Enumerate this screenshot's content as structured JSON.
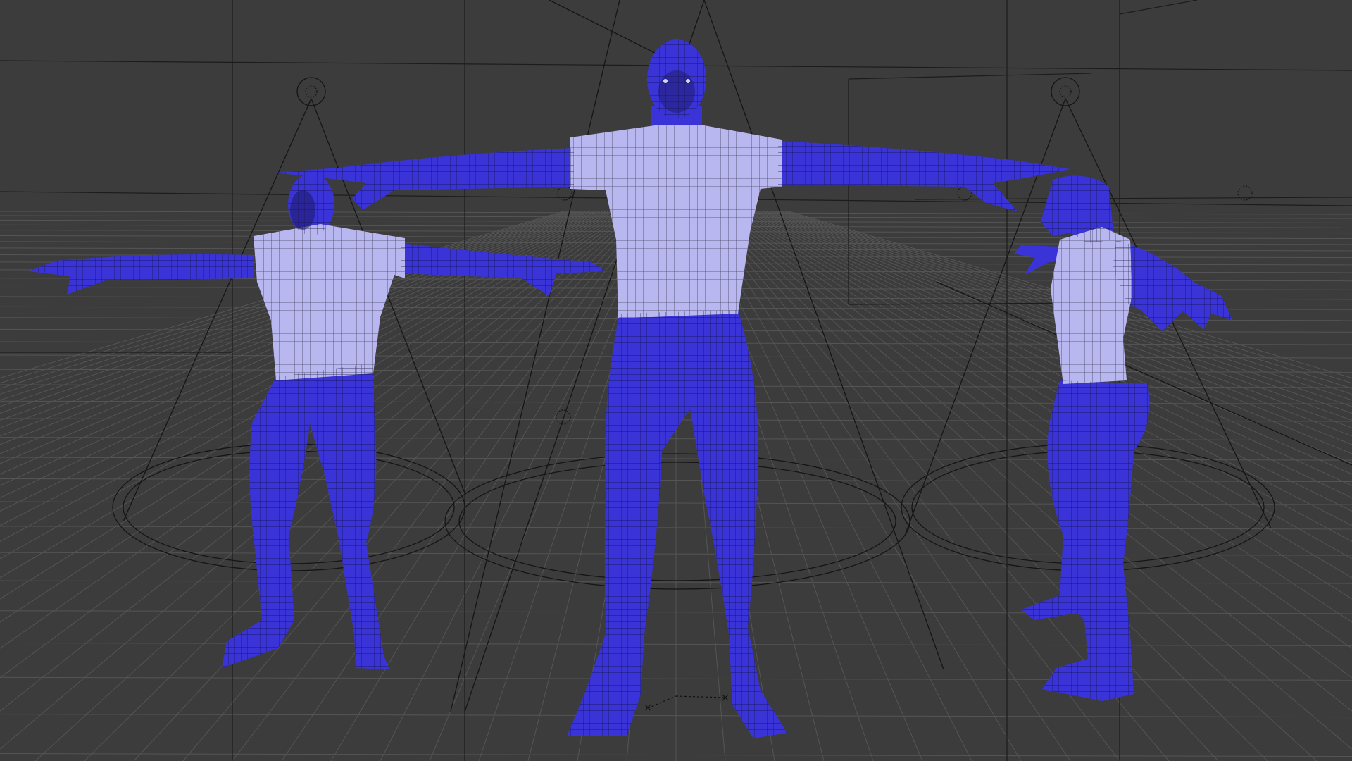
{
  "viewport": {
    "view": "perspective",
    "background_color": "#3c3c3c",
    "grid_color": "#555555",
    "skin_color": "#3a34d8",
    "shirt_color": "#b9b7ef"
  },
  "figures": [
    {
      "name": "female-figure",
      "pose": "t-pose",
      "view": "front"
    },
    {
      "name": "male-figure",
      "pose": "t-pose",
      "view": "front"
    },
    {
      "name": "creature-figure",
      "pose": "t-pose",
      "view": "side"
    }
  ],
  "icons": [
    "camera-icon",
    "light-icon",
    "axis-gizmo-icon"
  ]
}
